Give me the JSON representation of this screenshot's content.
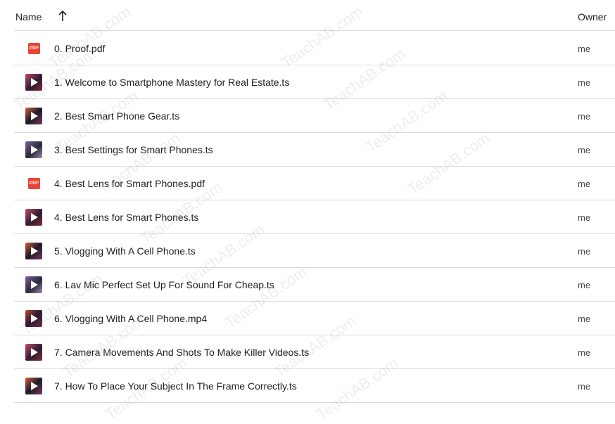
{
  "header": {
    "name_label": "Name",
    "owner_label": "Owner"
  },
  "files": [
    {
      "name": "0. Proof.pdf",
      "owner": "me",
      "type": "pdf"
    },
    {
      "name": "1. Welcome to Smartphone Mastery for Real Estate.ts",
      "owner": "me",
      "type": "video"
    },
    {
      "name": "2. Best Smart Phone Gear.ts",
      "owner": "me",
      "type": "video"
    },
    {
      "name": "3. Best Settings for Smart Phones.ts",
      "owner": "me",
      "type": "video"
    },
    {
      "name": "4. Best Lens for Smart Phones.pdf",
      "owner": "me",
      "type": "pdf"
    },
    {
      "name": "4. Best Lens for Smart Phones.ts",
      "owner": "me",
      "type": "video"
    },
    {
      "name": "5. Vlogging With A Cell Phone.ts",
      "owner": "me",
      "type": "video"
    },
    {
      "name": "6. Lav Mic Perfect Set Up For Sound For Cheap.ts",
      "owner": "me",
      "type": "video"
    },
    {
      "name": "6. Vlogging With A Cell Phone.mp4",
      "owner": "me",
      "type": "video"
    },
    {
      "name": "7. Camera Movements And Shots To Make Killer Videos.ts",
      "owner": "me",
      "type": "video"
    },
    {
      "name": "7. How To Place Your Subject In The Frame Correctly.ts",
      "owner": "me",
      "type": "video"
    }
  ],
  "icons": {
    "pdf_label": "PDF",
    "sort": "arrow-up-icon"
  },
  "watermark": "TeachAB.com",
  "colors": {
    "pdf_red": "#ea4335",
    "divider": "#dadce0"
  }
}
